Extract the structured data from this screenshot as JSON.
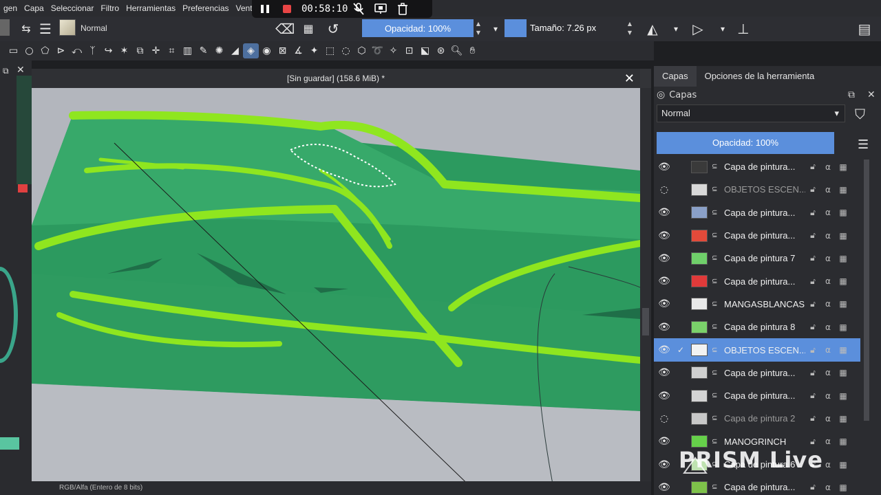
{
  "menubar": {
    "items": [
      "gen",
      "Capa",
      "Seleccionar",
      "Filtro",
      "Herramientas",
      "Preferencias",
      "Ventana"
    ]
  },
  "recorder": {
    "time": "00:58:10"
  },
  "tool_options": {
    "blend_mode": "Normal",
    "opacity_label": "Opacidad: 100%",
    "size_label": "Tamaño: 7.26 px"
  },
  "document": {
    "title": "[Sin guardar]  (158.6 MiB) *",
    "color_model": "RGB/Alfa (Entero de 8 bits)"
  },
  "right_panel": {
    "tabs": [
      "Capas",
      "Opciones de la herramienta"
    ],
    "layers_title": "Capas",
    "blend_mode": "Normal",
    "opacity_label": "Opacidad:  100%",
    "layers": [
      {
        "name": "Capa de pintura...",
        "visible": true,
        "thumb": "#3a3a3a",
        "selected": false
      },
      {
        "name": "OBJETOS ESCEN...",
        "visible": false,
        "thumb": "#d8d8d8",
        "selected": false
      },
      {
        "name": "Capa de pintura...",
        "visible": true,
        "thumb": "#8aa0c8",
        "selected": false
      },
      {
        "name": "Capa de pintura...",
        "visible": true,
        "thumb": "#e24a3a",
        "selected": false
      },
      {
        "name": "Capa de pintura 7",
        "visible": true,
        "thumb": "#6fcf6a",
        "selected": false
      },
      {
        "name": "Capa de pintura...",
        "visible": true,
        "thumb": "#e03a3a",
        "selected": false
      },
      {
        "name": "MANGASBLANCAS",
        "visible": true,
        "thumb": "#e8e8e8",
        "selected": false
      },
      {
        "name": "Capa de pintura 8",
        "visible": true,
        "thumb": "#7ad16a",
        "selected": false
      },
      {
        "name": "OBJETOS ESCEN...",
        "visible": true,
        "thumb": "#f2f2f2",
        "selected": true
      },
      {
        "name": "Capa de pintura...",
        "visible": true,
        "thumb": "#cfcfcf",
        "selected": false
      },
      {
        "name": "Capa de pintura...",
        "visible": true,
        "thumb": "#d4d4d4",
        "selected": false
      },
      {
        "name": "Capa de pintura 2",
        "visible": false,
        "thumb": "#c8c8c8",
        "selected": false
      },
      {
        "name": "MANOGRINCH",
        "visible": true,
        "thumb": "#66d04a",
        "selected": false
      },
      {
        "name": "Capa de pintura 6",
        "visible": true,
        "thumb": "#bfe3b0",
        "selected": false
      },
      {
        "name": "Capa de pintura...",
        "visible": true,
        "thumb": "#7ec24a",
        "selected": false
      }
    ]
  },
  "watermark": "PRISM Live"
}
